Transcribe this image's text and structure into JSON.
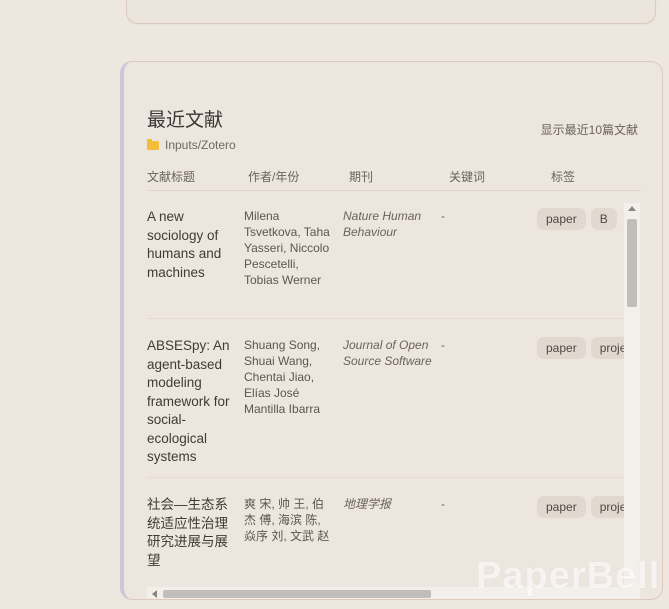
{
  "card": {
    "title": "最近文献",
    "path": "Inputs/Zotero",
    "recent_note": "显示最近10篇文献"
  },
  "table": {
    "headers": [
      "文献标题",
      "作者/年份",
      "期刊",
      "关键词",
      "标签"
    ],
    "rows": [
      {
        "title": "A new sociology of humans and machines",
        "authors": "Milena Tsvetkova, Taha Yasseri, Niccolo Pescetelli, Tobias Werner",
        "journal": "Nature Human Behaviour",
        "keywords": "-",
        "tags": [
          "paper",
          "B"
        ]
      },
      {
        "title": "ABSESpy: An agent-based modeling framework for social-ecological systems",
        "authors": "Shuang Song, Shuai Wang, Chentai Jiao, Elías José Mantilla Ibarra",
        "journal": "Journal of Open Source Software",
        "keywords": "-",
        "tags": [
          "paper",
          "proje"
        ]
      },
      {
        "title": "社会—生态系统适应性治理研究进展与展望",
        "authors": "爽 宋, 帅 王, 伯杰 傅, 海滨 陈, 焱序 刘, 文武 赵",
        "journal": "地理学报",
        "keywords": "-",
        "tags": [
          "paper",
          "proje"
        ]
      }
    ]
  },
  "watermark": "PaperBell",
  "colors": {
    "background": "#eee7e0",
    "card": "#ede6df",
    "accent_border": "#cfc6dc",
    "tag_bg": "#e1d8cf",
    "folder": "#f2bd3b"
  },
  "icons": {
    "folder": "folder-icon"
  }
}
